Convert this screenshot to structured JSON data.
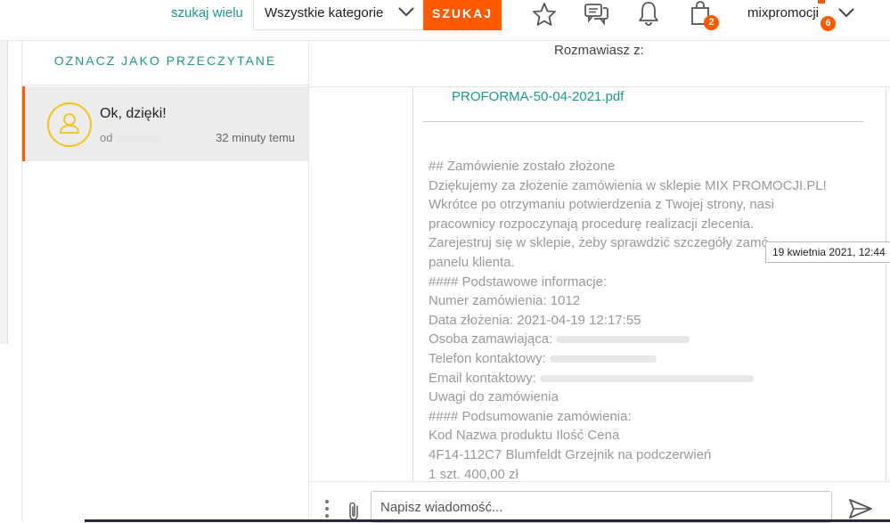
{
  "header": {
    "search_many": "szukaj wielu",
    "category": "Wszystkie kategorie",
    "search_button": "SZUKAJ",
    "cart_count": "2",
    "user_name": "mixpromocji",
    "notifications_count": "6"
  },
  "conversations": {
    "mark_read": "OZNACZ JAKO PRZECZYTANE",
    "items": [
      {
        "message": "Ok, dzięki!",
        "from_prefix": "od",
        "time": "32 minuty temu"
      }
    ]
  },
  "chat": {
    "talking_with": "Rozmawiasz z:",
    "attachment": "PROFORMA-50-04-2021.pdf",
    "lines": [
      "## Zamówienie zostało złożone",
      "Dziękujemy za złożenie zamówienia w sklepie MIX PROMOCJI.PL!",
      "Wkrótce po otrzymaniu potwierdzenia z Twojej strony, nasi",
      "pracownicy rozpoczynają procedurę realizacji zlecenia.",
      "Zarejestruj się w sklepie, żeby sprawdzić szczegóły zamó",
      "panelu klienta.",
      "#### Podstawowe informacje:",
      "Numer zamówienia: 1012",
      "Data złożenia: 2021-04-19 12:17:55",
      "Osoba zamawiająca:",
      "Telefon kontaktowy:",
      "Email kontaktowy:",
      "Uwagi do zamówienia",
      "#### Podsumowanie zamówienia:",
      "Kod Nazwa produktu Ilość Cena",
      "4F14-112C7 Blumfeldt Grzejnik na podczerwień",
      "1 szt. 400,00 zł"
    ],
    "tooltip": "19 kwietnia 2021, 12:44",
    "input_placeholder": "Napisz wiadomość..."
  },
  "colors": {
    "accent_orange": "#ff5a00",
    "accent_teal": "#1a9a8a",
    "avatar_yellow": "#f4c21b"
  }
}
